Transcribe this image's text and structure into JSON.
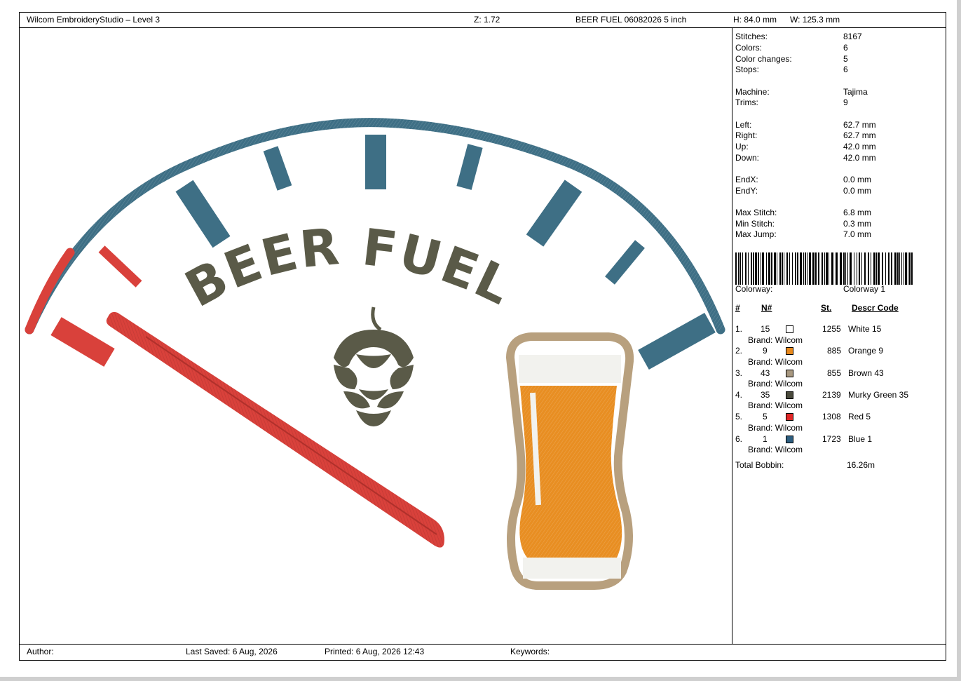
{
  "header": {
    "app_title": "Wilcom EmbroideryStudio – Level 3",
    "zoom": "Z: 1.72",
    "design_name": "BEER FUEL 06082026 5 inch",
    "height": "H: 84.0 mm",
    "width": "W: 125.3 mm"
  },
  "design": {
    "title_text": "BEER FUEL",
    "colors": {
      "gauge_blue": "#3e6f85",
      "red": "#d9413b",
      "text_green": "#5a5a48",
      "glass_brown": "#b8a07e",
      "beer_orange": "#e88e22",
      "white_thread": "#f2f2ee"
    },
    "icons": [
      "gauge-arc",
      "needle",
      "hop-cone-icon",
      "beer-glass-icon"
    ]
  },
  "stats": {
    "stitches_label": "Stitches:",
    "stitches": "8167",
    "colors_label": "Colors:",
    "colors": "6",
    "color_changes_label": "Color changes:",
    "color_changes": "5",
    "stops_label": "Stops:",
    "stops": "6",
    "machine_label": "Machine:",
    "machine": "Tajima",
    "trims_label": "Trims:",
    "trims": "9",
    "left_label": "Left:",
    "left": "62.7 mm",
    "right_label": "Right:",
    "right": "62.7 mm",
    "up_label": "Up:",
    "up": "42.0 mm",
    "down_label": "Down:",
    "down": "42.0 mm",
    "endx_label": "EndX:",
    "endx": "0.0 mm",
    "endy_label": "EndY:",
    "endy": "0.0 mm",
    "max_stitch_label": "Max Stitch:",
    "max_stitch": "6.8 mm",
    "min_stitch_label": "Min Stitch:",
    "min_stitch": "0.3 mm",
    "max_jump_label": "Max Jump:",
    "max_jump": "7.0 mm",
    "colorway_label": "Colorway:",
    "colorway": "Colorway 1"
  },
  "color_table": {
    "headers": {
      "num": "#",
      "n": "N#",
      "st": "St.",
      "descr": "Descr  Code"
    },
    "rows": [
      {
        "idx": "1.",
        "n": "15",
        "color": "#ffffff",
        "st": "1255",
        "descr": "White 15",
        "brand": "Brand: Wilcom"
      },
      {
        "idx": "2.",
        "n": "9",
        "color": "#e8891d",
        "st": "885",
        "descr": "Orange 9",
        "brand": "Brand: Wilcom"
      },
      {
        "idx": "3.",
        "n": "43",
        "color": "#a89880",
        "st": "855",
        "descr": "Brown 43",
        "brand": "Brand: Wilcom"
      },
      {
        "idx": "4.",
        "n": "35",
        "color": "#4a4a3c",
        "st": "2139",
        "descr": "Murky Green 35",
        "brand": "Brand: Wilcom"
      },
      {
        "idx": "5.",
        "n": "5",
        "color": "#e02626",
        "st": "1308",
        "descr": "Red 5",
        "brand": "Brand: Wilcom"
      },
      {
        "idx": "6.",
        "n": "1",
        "color": "#2d5e80",
        "st": "1723",
        "descr": "Blue 1",
        "brand": "Brand: Wilcom"
      }
    ],
    "total_bobbin_label": "Total Bobbin:",
    "total_bobbin": "16.26m"
  },
  "footer": {
    "author_label": "Author:",
    "last_saved": "Last Saved:  6 Aug, 2026",
    "printed": "Printed:  6 Aug, 2026 12:43",
    "keywords_label": "Keywords:"
  }
}
